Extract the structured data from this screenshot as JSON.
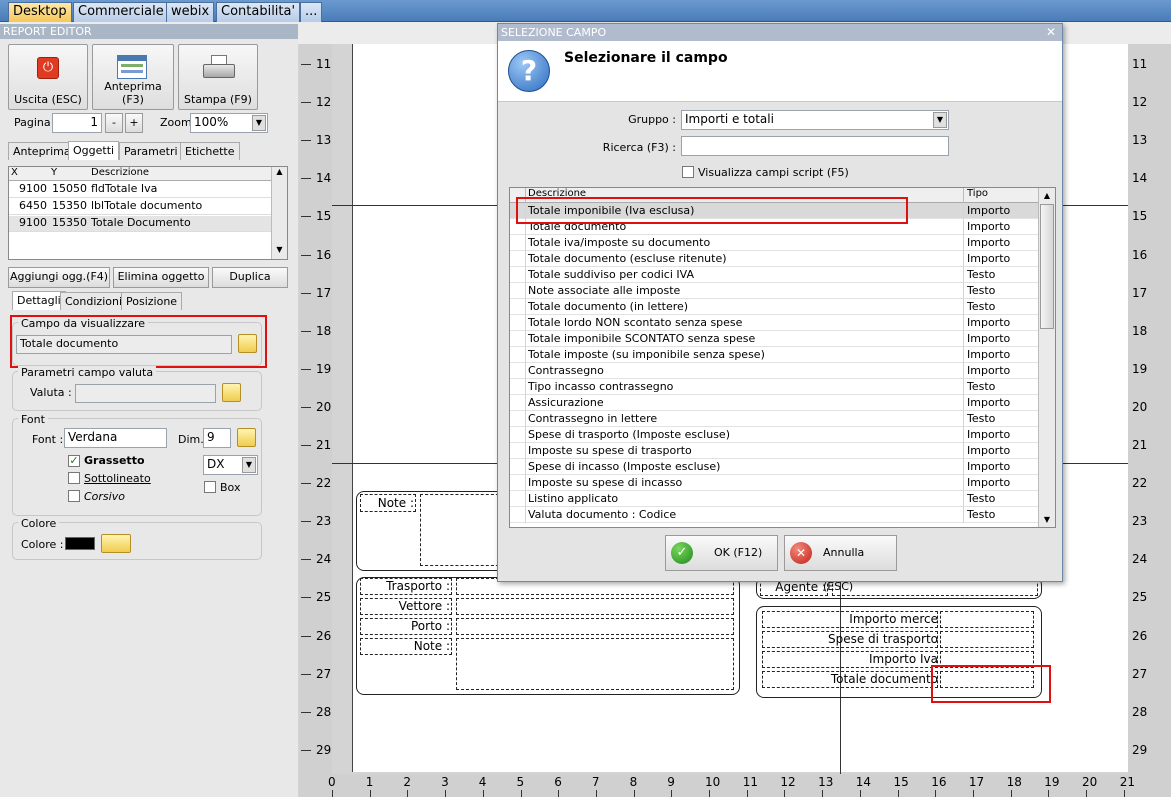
{
  "tabs": [
    {
      "label": "Desktop",
      "active": true
    },
    {
      "label": "Commerciale",
      "active": false
    },
    {
      "label": "webix",
      "active": false
    },
    {
      "label": "Contabilita'",
      "active": false
    },
    {
      "label": "...",
      "active": false
    }
  ],
  "editor": {
    "title": "REPORT EDITOR",
    "buttons": {
      "exit": "Uscita (ESC)",
      "preview": "Anteprima (F3)",
      "print": "Stampa (F9)"
    },
    "page_label": "Pagina",
    "page_value": "1",
    "minus": "-",
    "plus": "+",
    "zoom_label": "Zoom",
    "zoom_value": "100%",
    "top_tabs": [
      "Anteprima",
      "Oggetti",
      "Parametri",
      "Etichette"
    ],
    "objects": {
      "headers": [
        "X",
        "Y",
        "Descrizione"
      ],
      "rows": [
        {
          "x": "9100",
          "y": "15050",
          "desc": "fldTotale Iva"
        },
        {
          "x": "6450",
          "y": "15350",
          "desc": "lblTotale documento"
        },
        {
          "x": "9100",
          "y": "15350",
          "desc": "Totale Documento"
        }
      ]
    },
    "obj_buttons": {
      "add": "Aggiungi ogg.(F4)",
      "delete": "Elimina oggetto",
      "dup": "Duplica"
    },
    "detail_tabs": [
      "Dettagli",
      "Condizioni",
      "Posizione"
    ],
    "field_group": {
      "title": "Campo da visualizzare",
      "value": "Totale documento"
    },
    "currency_group": {
      "title": "Parametri campo valuta",
      "label": "Valuta :",
      "value": ""
    },
    "font_group": {
      "title": "Font",
      "font_label": "Font :",
      "font_value": "Verdana",
      "dim_label": "Dim.",
      "dim_value": "9",
      "bold": "Grassetto",
      "underline": "Sottolineato",
      "italic": "Corsivo",
      "align": "DX",
      "box": "Box"
    },
    "color_group": {
      "title": "Colore",
      "label": "Colore :",
      "swatch": "#000000"
    }
  },
  "ruler": {
    "left": [
      "11",
      "12",
      "13",
      "14",
      "15",
      "16",
      "17",
      "18",
      "19",
      "20",
      "21",
      "22",
      "23",
      "24",
      "25",
      "26",
      "27",
      "28",
      "29"
    ],
    "bottom": [
      "0",
      "1",
      "2",
      "3",
      "4",
      "5",
      "6",
      "7",
      "8",
      "9",
      "10",
      "11",
      "12",
      "13",
      "14",
      "15",
      "16",
      "17",
      "18",
      "19",
      "20",
      "21"
    ]
  },
  "report": {
    "note": "Note :",
    "transport": [
      "Trasporto :",
      "Vettore :",
      "Porto :",
      "Note :"
    ],
    "agent": "Agente :",
    "totals": [
      "Importo merce",
      "Spese di trasporto",
      "Importo Iva",
      "Totale documento"
    ]
  },
  "dialog": {
    "title": "SELEZIONE CAMPO",
    "heading": "Selezionare il campo",
    "group_label": "Gruppo :",
    "group_value": "Importi e totali",
    "search_label": "Ricerca (F3) :",
    "search_value": "",
    "script_check": "Visualizza campi script (F5)",
    "headers": [
      "Descrizione",
      "Tipo"
    ],
    "rows": [
      {
        "desc": "Totale imponibile (Iva esclusa)",
        "type": "Importo"
      },
      {
        "desc": "Totale documento",
        "type": "Importo"
      },
      {
        "desc": "Totale iva/imposte su documento",
        "type": "Importo"
      },
      {
        "desc": "Totale documento (escluse ritenute)",
        "type": "Importo"
      },
      {
        "desc": "Totale suddiviso per codici IVA",
        "type": "Testo"
      },
      {
        "desc": "Note associate alle imposte",
        "type": "Testo"
      },
      {
        "desc": "Totale documento (in lettere)",
        "type": "Testo"
      },
      {
        "desc": "Totale lordo NON scontato senza spese",
        "type": "Importo"
      },
      {
        "desc": "Totale imponibile SCONTATO senza spese",
        "type": "Importo"
      },
      {
        "desc": "Totale imposte (su imponibile senza spese)",
        "type": "Importo"
      },
      {
        "desc": "Contrassegno",
        "type": "Importo"
      },
      {
        "desc": "Tipo incasso contrassegno",
        "type": "Testo"
      },
      {
        "desc": "Assicurazione",
        "type": "Importo"
      },
      {
        "desc": "Contrassegno in lettere",
        "type": "Testo"
      },
      {
        "desc": "Spese di trasporto (Imposte escluse)",
        "type": "Importo"
      },
      {
        "desc": "Imposte su spese di trasporto",
        "type": "Importo"
      },
      {
        "desc": "Spese di incasso (Imposte escluse)",
        "type": "Importo"
      },
      {
        "desc": "Imposte su spese di incasso",
        "type": "Importo"
      },
      {
        "desc": "Listino applicato",
        "type": "Testo"
      },
      {
        "desc": "Valuta documento : Codice",
        "type": "Testo"
      }
    ],
    "ok": "OK (F12)",
    "cancel": "Annulla (ESC)"
  }
}
